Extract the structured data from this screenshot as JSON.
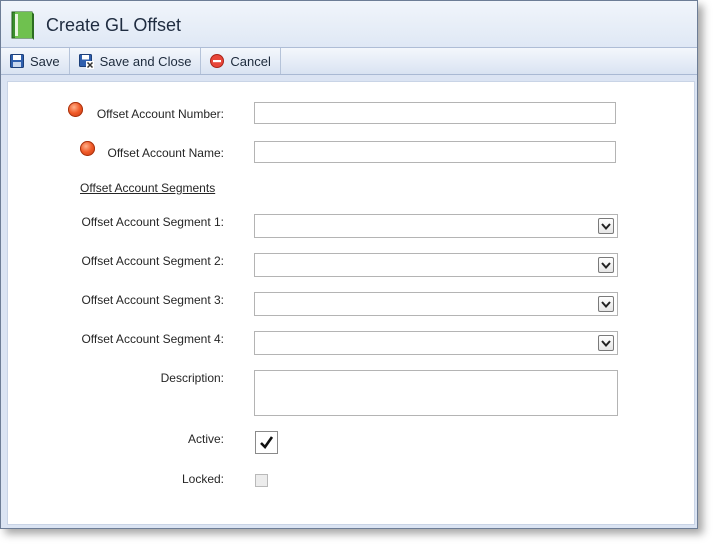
{
  "window": {
    "title": "Create GL Offset",
    "icon": "green-book-icon"
  },
  "toolbar": {
    "save_label": "Save",
    "save_close_label": "Save and Close",
    "cancel_label": "Cancel"
  },
  "form": {
    "offset_account_number_label": "Offset Account Number:",
    "offset_account_number_value": "",
    "offset_account_name_label": "Offset Account Name:",
    "offset_account_name_value": "",
    "segments_link": "Offset Account Segments",
    "segment1_label": "Offset Account Segment 1:",
    "segment1_value": "",
    "segment2_label": "Offset Account Segment 2:",
    "segment2_value": "",
    "segment3_label": "Offset Account Segment 3:",
    "segment3_value": "",
    "segment4_label": "Offset Account Segment 4:",
    "segment4_value": "",
    "description_label": "Description:",
    "description_value": "",
    "active_label": "Active:",
    "active_checked": true,
    "locked_label": "Locked:",
    "locked_checked": false
  },
  "colors": {
    "required_indicator": "#f05a28",
    "titlebar": "#dfe8f5",
    "border": "#6d7d96"
  }
}
